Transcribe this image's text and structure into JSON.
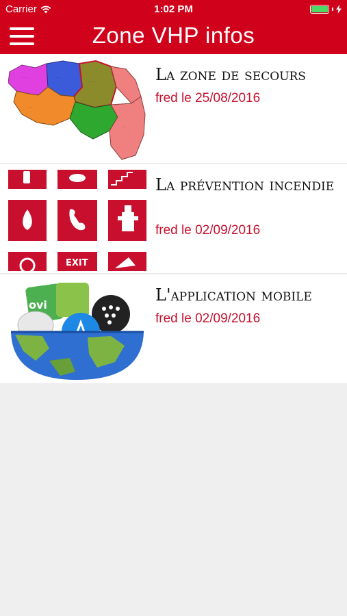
{
  "status_bar": {
    "carrier": "Carrier",
    "time": "1:02 PM",
    "battery_color": "#4cd964"
  },
  "nav": {
    "title": "Zone VHP infos",
    "menu_icon": "hamburger-menu-icon",
    "background": "#d0021b"
  },
  "articles": [
    {
      "title": "La zone de secours",
      "meta": "fred le 25/08/2016",
      "thumbnail": "zone-map-image"
    },
    {
      "title": "La prévention incendie",
      "meta": "fred le 02/09/2016",
      "thumbnail": "fire-safety-signs-image"
    },
    {
      "title": "L'application mobile",
      "meta": "fred le 02/09/2016",
      "thumbnail": "app-store-globe-image"
    }
  ],
  "colors": {
    "accent": "#d0021b",
    "meta_text": "#c8102e",
    "background": "#efefef"
  }
}
